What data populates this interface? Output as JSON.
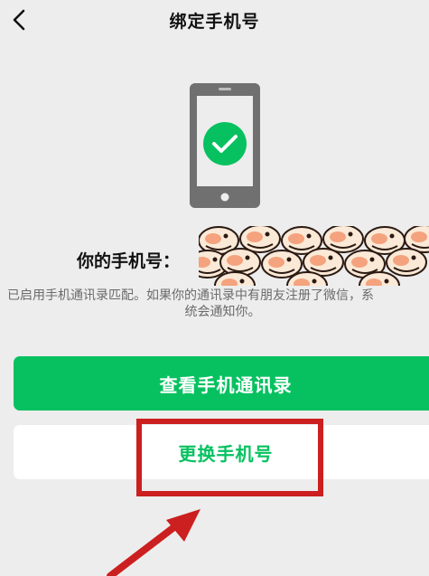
{
  "header": {
    "title": "绑定手机号"
  },
  "icons": {
    "back": "chevron-left-icon",
    "phone": "smartphone-icon",
    "check": "check-circle-icon"
  },
  "phone_label": "你的手机号：",
  "notice": {
    "line1": "已启用手机通讯录匹配。如果你的通讯录中有朋友注册了微信，系",
    "line2": "统会通知你。"
  },
  "buttons": {
    "view_contacts": "查看手机通讯录",
    "change_number": "更换手机号"
  },
  "colors": {
    "accent": "#07c160",
    "background": "#ededed",
    "annotation": "#cc1f1f",
    "phone_body": "#707070"
  }
}
